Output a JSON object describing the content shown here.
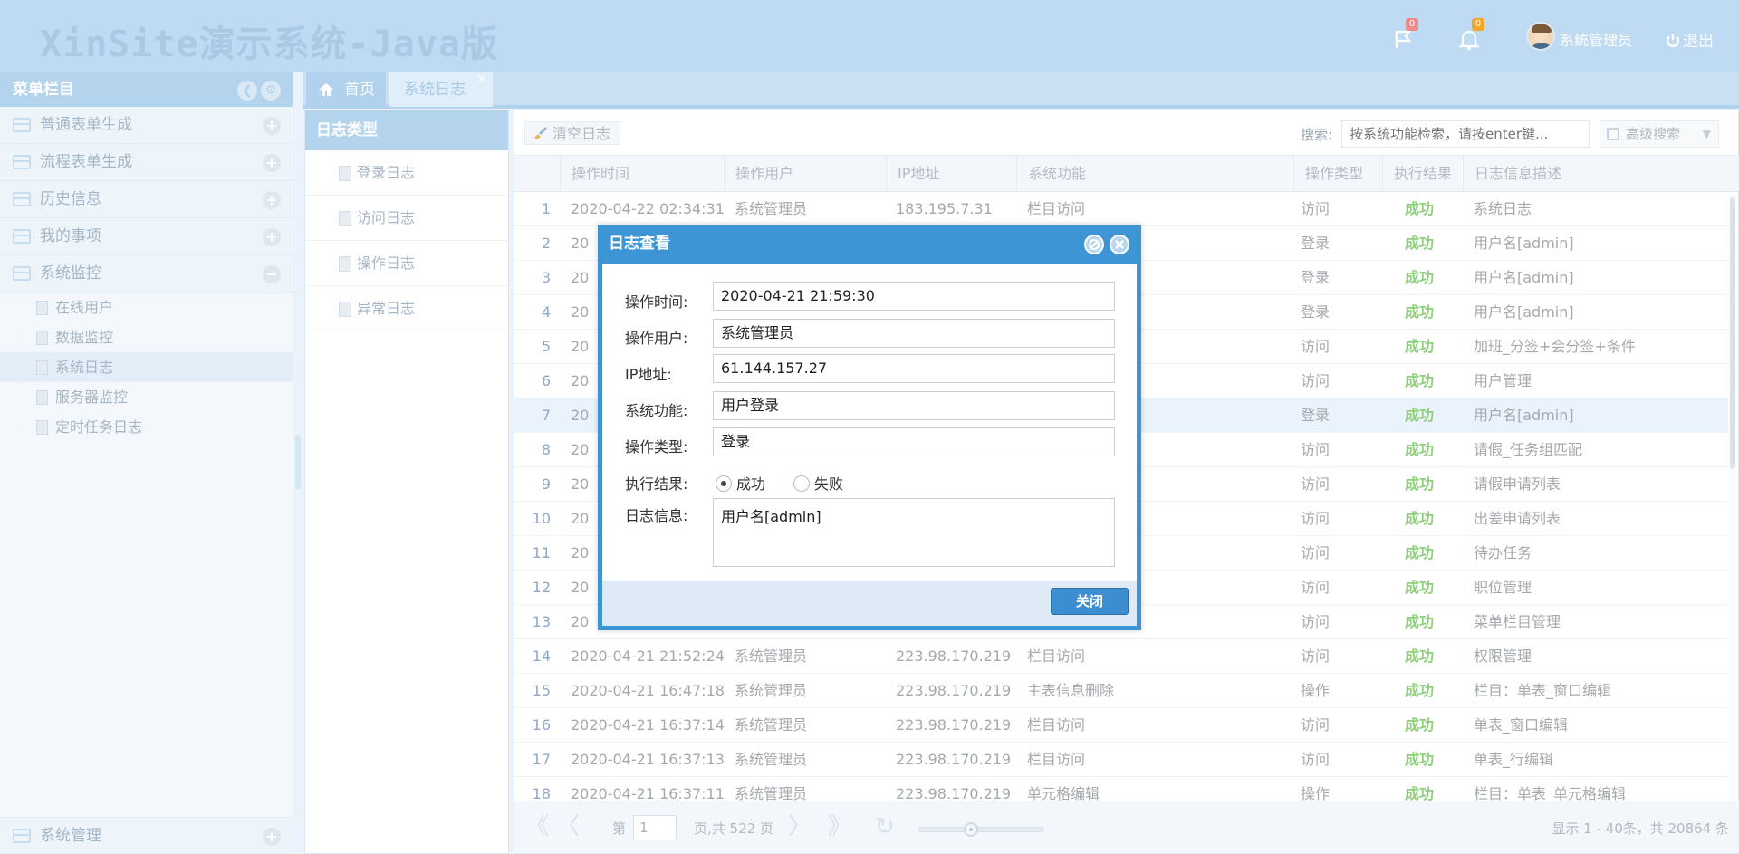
{
  "header": {
    "title": "XinSite演示系统-Java版",
    "flag_badge": "0",
    "bell_badge": "0",
    "username": "系统管理员",
    "logout_label": "退出"
  },
  "sidebar": {
    "title": "菜单栏目",
    "groups": [
      {
        "label": "普通表单生成",
        "toggle": "+"
      },
      {
        "label": "流程表单生成",
        "toggle": "+"
      },
      {
        "label": "历史信息",
        "toggle": "+"
      },
      {
        "label": "我的事项",
        "toggle": "+"
      },
      {
        "label": "系统监控",
        "toggle": "−"
      }
    ],
    "monitor_items": [
      "在线用户",
      "数据监控",
      "系统日志",
      "服务器监控",
      "定时任务日志"
    ],
    "bottom_group": {
      "label": "系统管理",
      "toggle": "+"
    }
  },
  "tabs": [
    {
      "label": "首页"
    },
    {
      "label": "系统日志",
      "close": "×"
    }
  ],
  "log_types": {
    "title": "日志类型",
    "items": [
      "登录日志",
      "访问日志",
      "操作日志",
      "异常日志"
    ]
  },
  "toolbar": {
    "clear_label": "清空日志",
    "search_label": "搜索:",
    "search_placeholder": "按系统功能检索，请按enter键...",
    "advanced_label": "高级搜索",
    "advanced_caret": "▼"
  },
  "table": {
    "columns": [
      "操作时间",
      "操作用户",
      "IP地址",
      "系统功能",
      "操作类型",
      "执行结果",
      "日志信息描述"
    ],
    "rows": [
      {
        "n": "1",
        "time": "2020-04-22 02:34:31",
        "user": "系统管理员",
        "ip": "183.195.7.31",
        "func": "栏目访问",
        "type": "访问",
        "result": "成功",
        "desc": "系统日志"
      },
      {
        "n": "2",
        "time": "20",
        "user": "",
        "ip": "",
        "func": "",
        "type": "登录",
        "result": "成功",
        "desc": "用户名[admin]"
      },
      {
        "n": "3",
        "time": "20",
        "user": "",
        "ip": "",
        "func": "",
        "type": "登录",
        "result": "成功",
        "desc": "用户名[admin]"
      },
      {
        "n": "4",
        "time": "20",
        "user": "",
        "ip": "",
        "func": "",
        "type": "登录",
        "result": "成功",
        "desc": "用户名[admin]"
      },
      {
        "n": "5",
        "time": "20",
        "user": "",
        "ip": "",
        "func": "",
        "type": "访问",
        "result": "成功",
        "desc": "加班_分签+会分签+条件"
      },
      {
        "n": "6",
        "time": "20",
        "user": "",
        "ip": "",
        "func": "",
        "type": "访问",
        "result": "成功",
        "desc": "用户管理"
      },
      {
        "n": "7",
        "time": "20",
        "user": "",
        "ip": "",
        "func": "",
        "type": "登录",
        "result": "成功",
        "desc": "用户名[admin]"
      },
      {
        "n": "8",
        "time": "20",
        "user": "",
        "ip": "",
        "func": "",
        "type": "访问",
        "result": "成功",
        "desc": "请假_任务组匹配"
      },
      {
        "n": "9",
        "time": "20",
        "user": "",
        "ip": "",
        "func": "",
        "type": "访问",
        "result": "成功",
        "desc": "请假申请列表"
      },
      {
        "n": "10",
        "time": "20",
        "user": "",
        "ip": "",
        "func": "",
        "type": "访问",
        "result": "成功",
        "desc": "出差申请列表"
      },
      {
        "n": "11",
        "time": "20",
        "user": "",
        "ip": "",
        "func": "",
        "type": "访问",
        "result": "成功",
        "desc": "待办任务"
      },
      {
        "n": "12",
        "time": "20",
        "user": "",
        "ip": "",
        "func": "",
        "type": "访问",
        "result": "成功",
        "desc": "职位管理"
      },
      {
        "n": "13",
        "time": "20",
        "user": "",
        "ip": "",
        "func": "",
        "type": "访问",
        "result": "成功",
        "desc": "菜单栏目管理"
      },
      {
        "n": "14",
        "time": "2020-04-21 21:52:24",
        "user": "系统管理员",
        "ip": "223.98.170.219",
        "func": "栏目访问",
        "type": "访问",
        "result": "成功",
        "desc": "权限管理"
      },
      {
        "n": "15",
        "time": "2020-04-21 16:47:18",
        "user": "系统管理员",
        "ip": "223.98.170.219",
        "func": "主表信息删除",
        "type": "操作",
        "result": "成功",
        "desc": "栏目：单表_窗口编辑"
      },
      {
        "n": "16",
        "time": "2020-04-21 16:37:14",
        "user": "系统管理员",
        "ip": "223.98.170.219",
        "func": "栏目访问",
        "type": "访问",
        "result": "成功",
        "desc": "单表_窗口编辑"
      },
      {
        "n": "17",
        "time": "2020-04-21 16:37:13",
        "user": "系统管理员",
        "ip": "223.98.170.219",
        "func": "栏目访问",
        "type": "访问",
        "result": "成功",
        "desc": "单表_行编辑"
      },
      {
        "n": "18",
        "time": "2020-04-21 16:37:11",
        "user": "系统管理员",
        "ip": "223.98.170.219",
        "func": "单元格编辑",
        "type": "操作",
        "result": "成功",
        "desc": "栏目：单表_单元格编辑"
      }
    ],
    "selected_row": "7"
  },
  "pager": {
    "first": "《",
    "prev": "〈",
    "page_prefix": "第",
    "page_value": "1",
    "page_suffix": "页,共 522 页",
    "next": "〉",
    "last": "》",
    "refresh": "↻",
    "info": "显示 1 - 40条，共 20864 条"
  },
  "modal": {
    "title": "日志查看",
    "fields": [
      {
        "label": "操作时间:",
        "value": "2020-04-21 21:59:30"
      },
      {
        "label": "操作用户:",
        "value": "系统管理员"
      },
      {
        "label": "IP地址:",
        "value": "61.144.157.27"
      },
      {
        "label": "系统功能:",
        "value": "用户登录"
      },
      {
        "label": "操作类型:",
        "value": "登录"
      }
    ],
    "result_label": "执行结果:",
    "result_options": [
      "成功",
      "失败"
    ],
    "result_selected": "成功",
    "info_label": "日志信息:",
    "info_value": "用户名[admin]",
    "close_label": "关闭"
  }
}
